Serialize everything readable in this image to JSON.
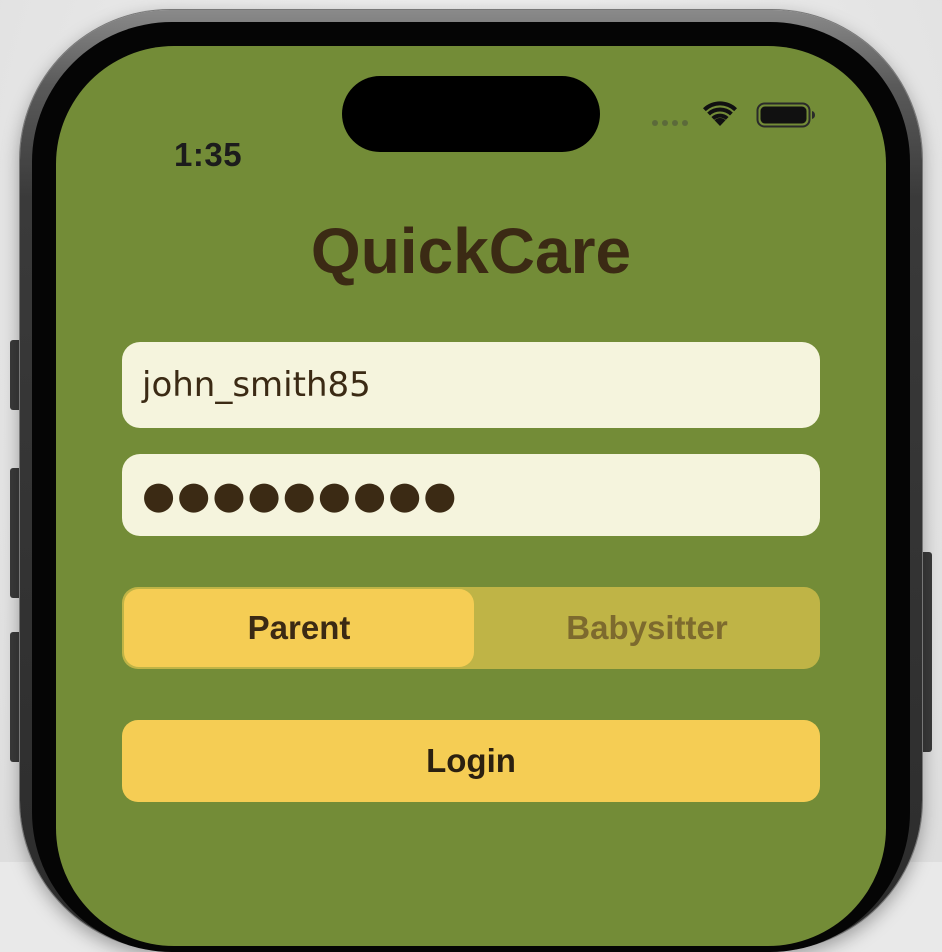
{
  "status_bar": {
    "time": "1:35",
    "signal_icon": "cellular-signal-icon",
    "wifi_icon": "wifi-icon",
    "battery_icon": "battery-icon"
  },
  "app": {
    "title": "QuickCare"
  },
  "login_form": {
    "username_value": "john_smith85",
    "password_value": "●●●●●●●●●",
    "role_options": [
      "Parent",
      "Babysitter"
    ],
    "selected_role": "Parent",
    "login_label": "Login"
  },
  "colors": {
    "background": "#738c37",
    "title_text": "#3b2a14",
    "field_background": "#f5f4dd",
    "segment_selected": "#f5cd54",
    "segment_track": "#bfb446",
    "segment_unselected_text": "#7d6a2e",
    "button_background": "#f5cd54"
  }
}
